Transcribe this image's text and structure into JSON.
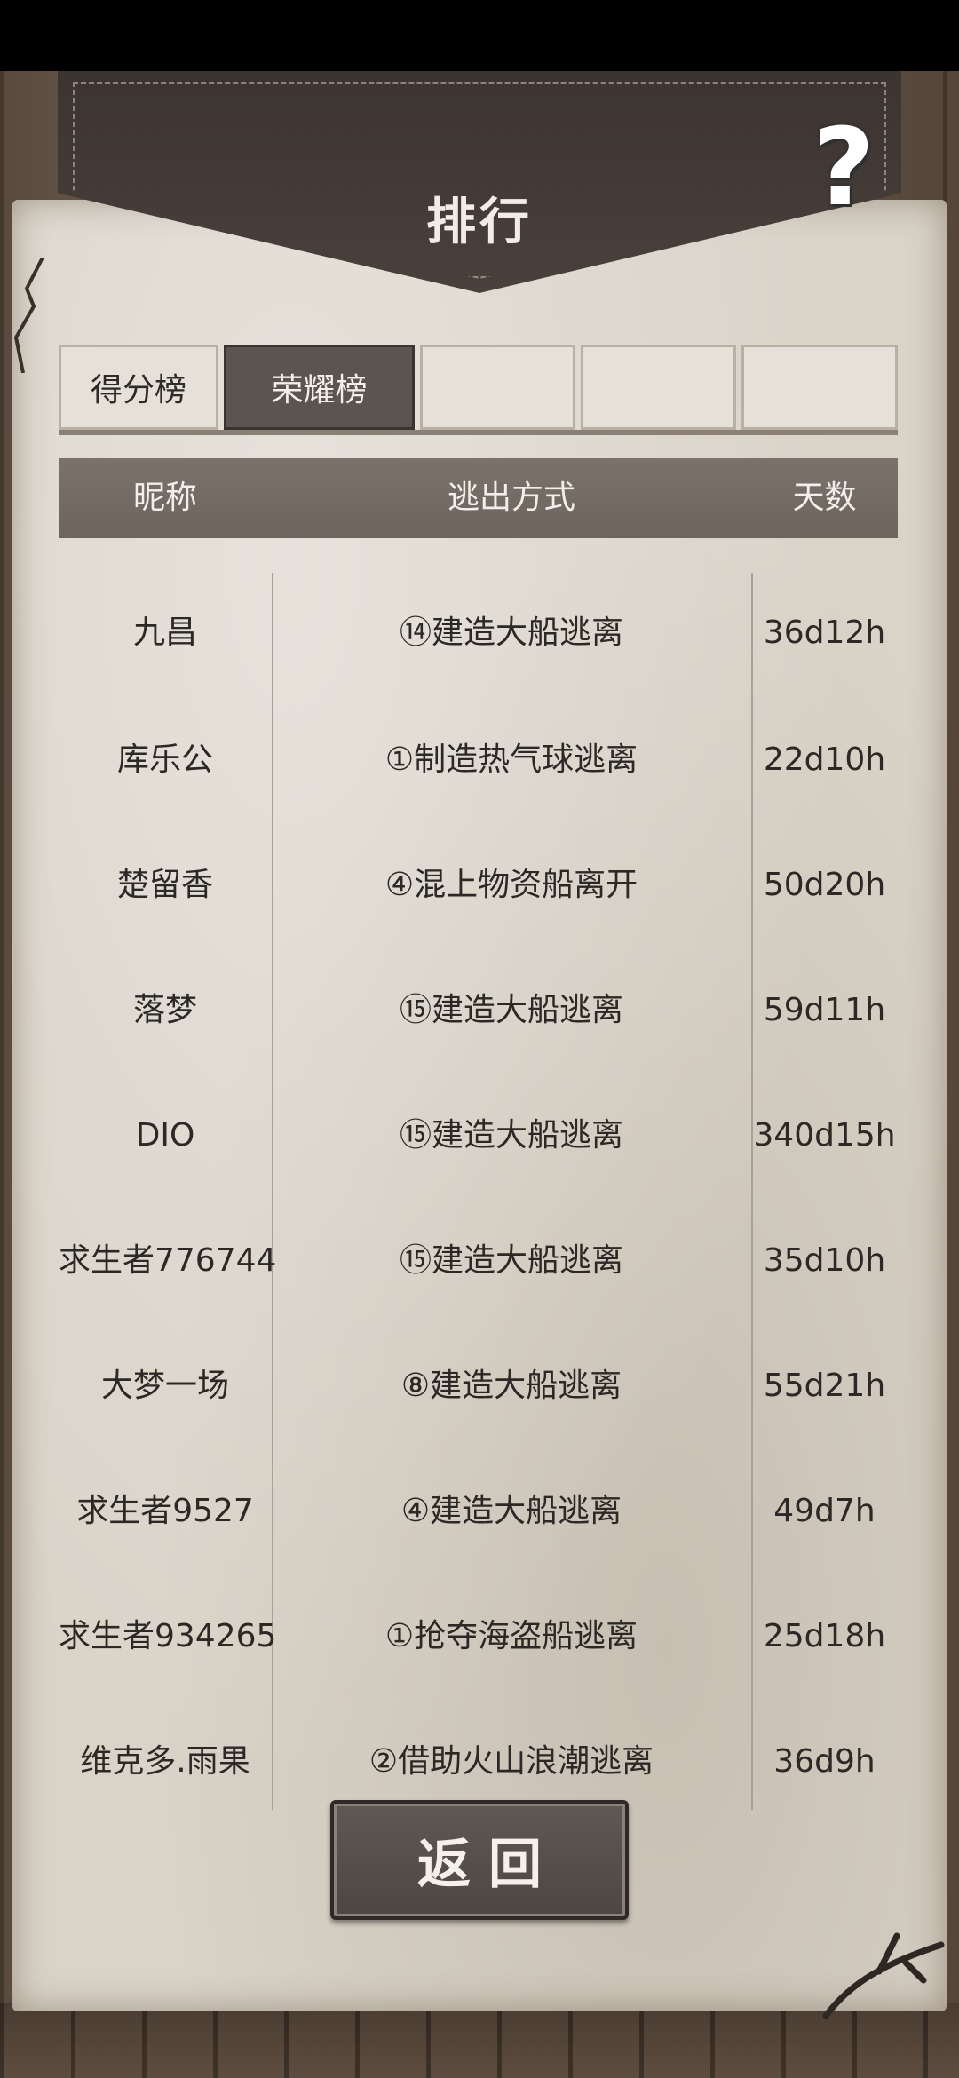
{
  "header": {
    "title": "排行",
    "help_icon": "question-mark-icon",
    "help_glyph": "?"
  },
  "tabs": [
    {
      "label": "得分榜",
      "active": false
    },
    {
      "label": "荣耀榜",
      "active": true
    },
    {
      "label": "",
      "active": false
    },
    {
      "label": "",
      "active": false
    },
    {
      "label": "",
      "active": false
    }
  ],
  "table": {
    "columns": [
      "昵称",
      "逃出方式",
      "天数"
    ],
    "rows": [
      {
        "name": "九昌",
        "method": "⑭建造大船逃离",
        "days": "36d12h"
      },
      {
        "name": "库乐公",
        "method": "①制造热气球逃离",
        "days": "22d10h"
      },
      {
        "name": "楚留香",
        "method": "④混上物资船离开",
        "days": "50d20h"
      },
      {
        "name": "落梦",
        "method": "⑮建造大船逃离",
        "days": "59d11h"
      },
      {
        "name": "DIO",
        "method": "⑮建造大船逃离",
        "days": "340d15h"
      },
      {
        "name": "求生者776744",
        "method": "⑮建造大船逃离",
        "days": "35d10h"
      },
      {
        "name": "大梦一场",
        "method": "⑧建造大船逃离",
        "days": "55d21h"
      },
      {
        "name": "求生者9527",
        "method": "④建造大船逃离",
        "days": "49d7h"
      },
      {
        "name": "求生者934265",
        "method": "①抢夺海盗船逃离",
        "days": "25d18h"
      },
      {
        "name": "维克多.雨果",
        "method": "②借助火山浪潮逃离",
        "days": "36d9h"
      }
    ]
  },
  "footer": {
    "back_label": "返回"
  },
  "colors": {
    "banner": "#3c3431",
    "paper": "#d9d3c8",
    "active_tab": "#5b5450",
    "header_bar": "#6c645d"
  }
}
